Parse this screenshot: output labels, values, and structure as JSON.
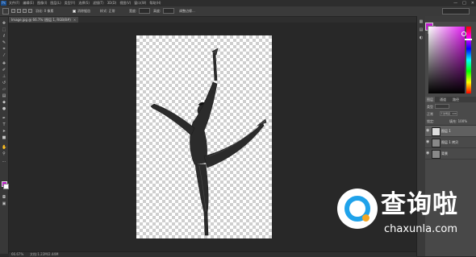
{
  "app": {
    "logo_text": "Ps"
  },
  "menu": {
    "items": [
      "文件(F)",
      "编辑(E)",
      "图像(I)",
      "图层(L)",
      "类型(Y)",
      "选择(S)",
      "滤镜(T)",
      "3D(D)",
      "视图(V)",
      "窗口(W)",
      "帮助(H)"
    ],
    "window_controls": [
      "—",
      "□",
      "✕"
    ]
  },
  "options_bar": {
    "feather_label": "羽化: 0 像素",
    "antialias_label": "消除锯齿",
    "style_label": "样式: 正常",
    "width_label": "宽度:",
    "height_label": "高度:",
    "refine_edge_label": "调整边缘..."
  },
  "document": {
    "tab_title": "Image.jpg @ 66.7% (图层 1, RGB/8#)",
    "tab_close": "×"
  },
  "status_bar": {
    "zoom": "66.67%",
    "doc_size": "文档:1.22M/2.44M"
  },
  "color_panel": {
    "tab_label": "颜色",
    "foreground_color": "#c21bd0",
    "background_color": "#ffffff"
  },
  "layers_panel": {
    "tabs": [
      "图层",
      "通道",
      "路径"
    ],
    "kind_label": "类型",
    "mode_label": "正常",
    "opacity_label": "不透明度: 100%",
    "lock_label": "锁定:",
    "fill_label": "填充: 100%",
    "layers": [
      {
        "name": "图层 1",
        "visible": true,
        "selected": true
      },
      {
        "name": "图层 1 拷贝",
        "visible": true,
        "selected": false
      },
      {
        "name": "背景",
        "visible": true,
        "selected": false
      }
    ]
  },
  "watermark": {
    "cn_text": "查询啦",
    "en_text": "chaxunla.com"
  },
  "icons": {
    "move": "move-icon",
    "marquee": "marquee-icon",
    "lasso": "lasso-icon",
    "quick_select": "quick-select-icon",
    "crop": "crop-icon",
    "eyedropper": "eyedropper-icon",
    "healing": "healing-brush-icon",
    "brush": "brush-icon",
    "stamp": "clone-stamp-icon",
    "history": "history-brush-icon",
    "eraser": "eraser-icon",
    "gradient": "gradient-icon",
    "blur": "blur-icon",
    "dodge": "dodge-icon",
    "pen": "pen-icon",
    "type": "type-icon",
    "path_select": "path-selection-icon",
    "shape": "shape-icon",
    "hand": "hand-icon",
    "zoom": "zoom-icon",
    "eye": "eye-icon"
  }
}
